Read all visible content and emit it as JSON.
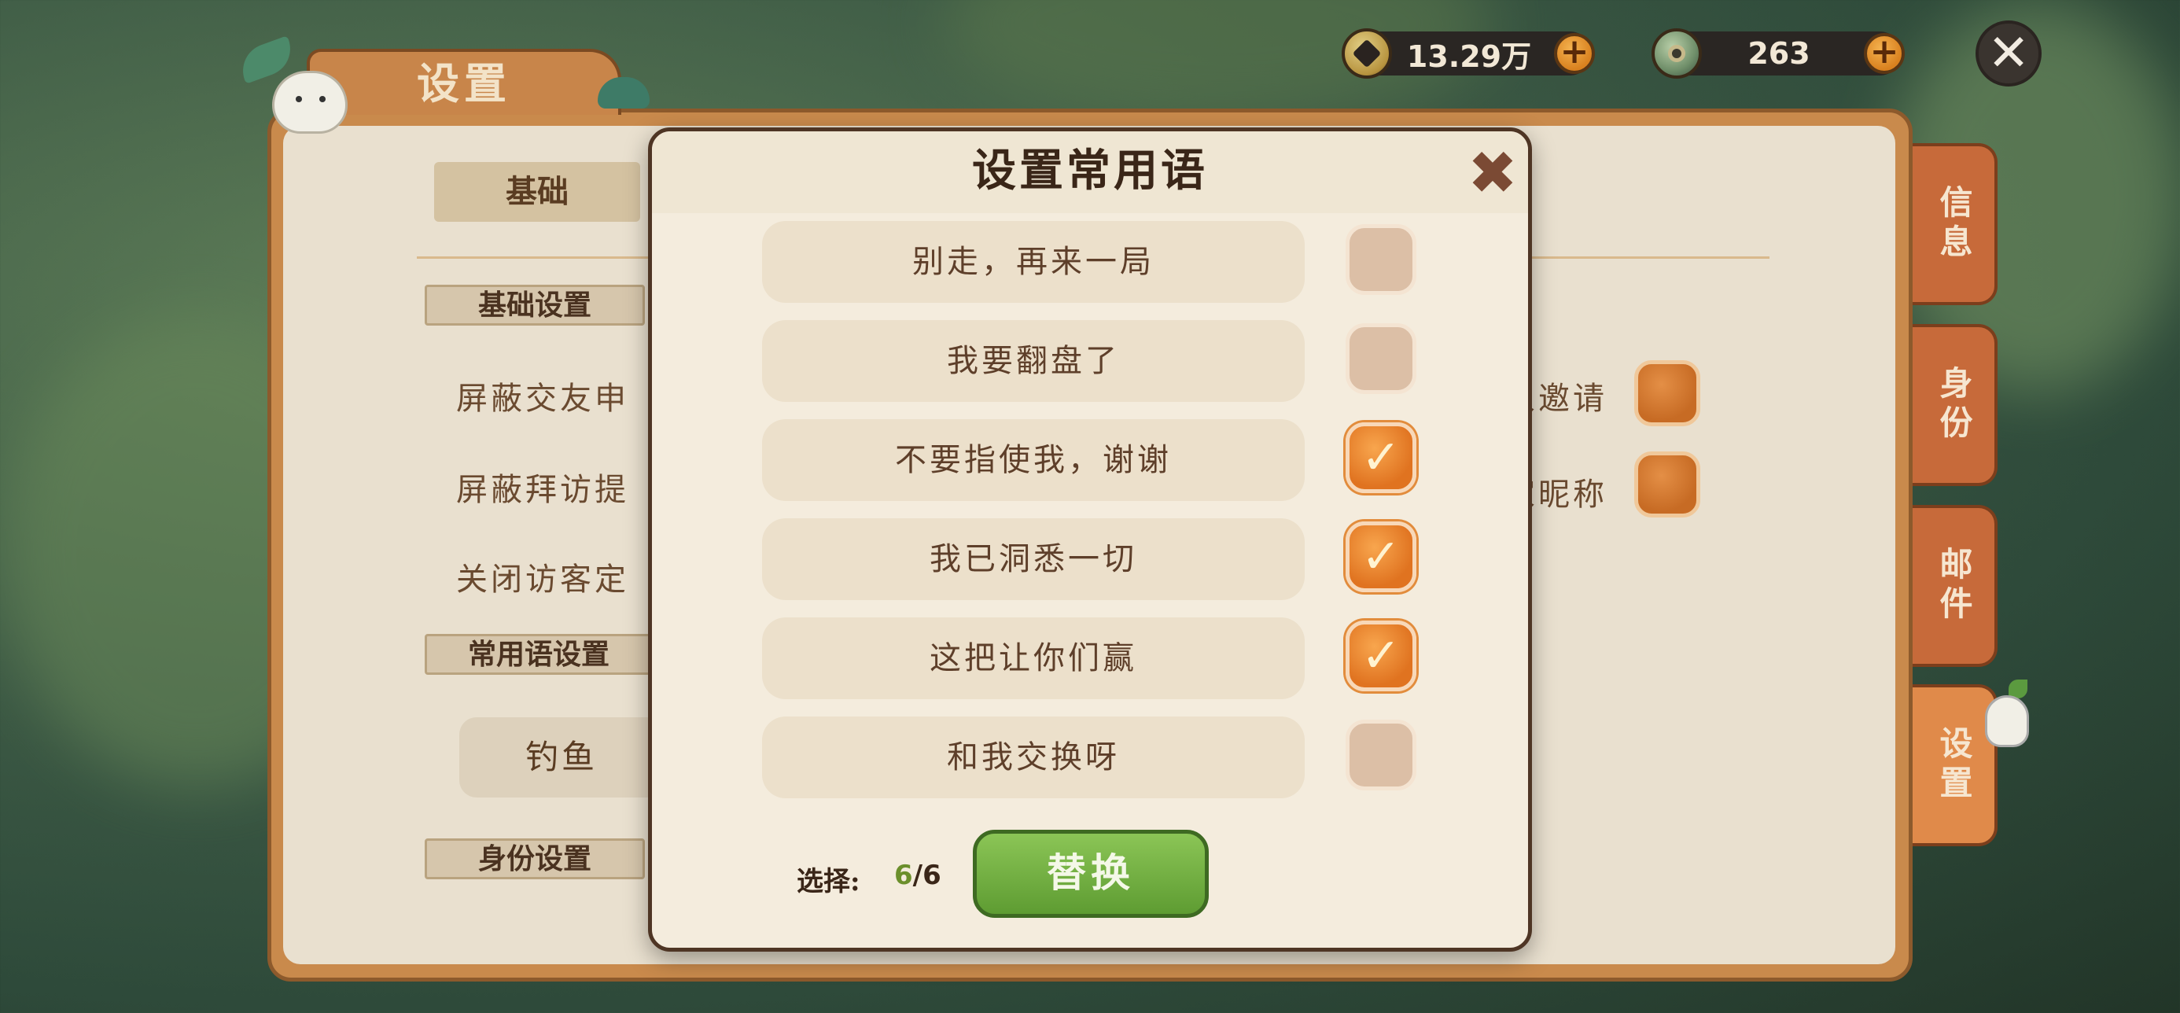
{
  "window": {
    "title": "设置"
  },
  "currency": [
    {
      "name": "gold",
      "value": "13.29万",
      "plus": "+"
    },
    {
      "name": "jade",
      "value": "263",
      "plus": "+"
    }
  ],
  "close_top": "✕",
  "tabs": {
    "basic": "基础"
  },
  "sections": {
    "basic_settings": "基础设置",
    "phrase_settings": "常用语设置",
    "identity_settings": "身份设置"
  },
  "settings": {
    "block_friend": "屏蔽交友申",
    "block_visit": "屏蔽拜访提",
    "close_visitor": "关闭访客定",
    "invite": "人邀请",
    "nickname": "家昵称"
  },
  "fish_button": "钓鱼",
  "side_tabs": [
    {
      "label": "信息"
    },
    {
      "label": "身份"
    },
    {
      "label": "邮件"
    },
    {
      "label": "设置",
      "active": true
    }
  ],
  "modal": {
    "title": "设置常用语",
    "close": "✖",
    "phrases": [
      {
        "text": "别走，再来一局",
        "checked": false
      },
      {
        "text": "我要翻盘了",
        "checked": false
      },
      {
        "text": "不要指使我，谢谢",
        "checked": true
      },
      {
        "text": "我已洞悉一切",
        "checked": true
      },
      {
        "text": "这把让你们赢",
        "checked": true
      },
      {
        "text": "和我交换呀",
        "checked": false
      }
    ],
    "select_label": "选择:",
    "selected": "6",
    "total": "/6",
    "replace_button": "替换"
  },
  "colors": {
    "accent_orange": "#e07320",
    "button_green": "#6ba93a",
    "panel_brown": "#c98a4c",
    "parchment": "#f4ecdd"
  }
}
